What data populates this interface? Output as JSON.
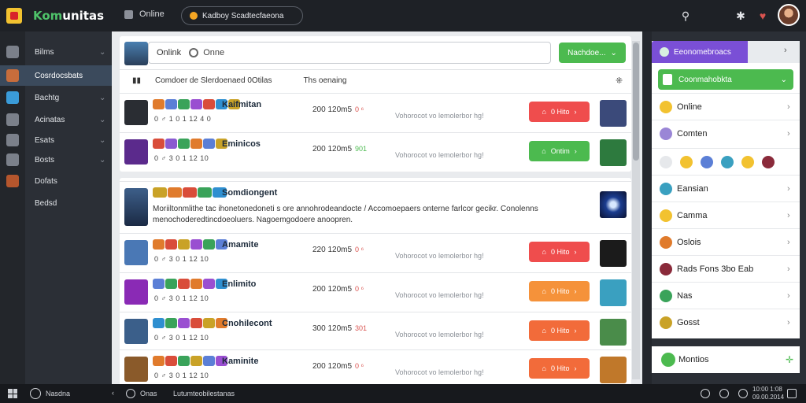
{
  "topbar": {
    "app_name_prefix": "Kom",
    "app_name_rest": "unitas",
    "nav_online": "Online",
    "pill_label": "Kadboy Scadtecfaeona"
  },
  "sidebar": {
    "items": [
      {
        "label": "Bilms",
        "icon": "grid-icon",
        "chevron": "⌄",
        "color": "#7b808a"
      },
      {
        "label": "Cosrdocsbats",
        "icon": "user-avatar-icon",
        "chevron": "",
        "color": "#c76d3c"
      },
      {
        "label": "Bachtg",
        "icon": "game-icon",
        "chevron": "⌄",
        "color": "#3a9bd8"
      },
      {
        "label": "Acinatas",
        "icon": "chat-icon",
        "chevron": "⌄",
        "color": "#7b808a"
      },
      {
        "label": "Esats",
        "icon": "bubble-icon",
        "chevron": "⌄",
        "color": "#7b808a"
      },
      {
        "label": "Bosts",
        "icon": "list-icon",
        "chevron": "⌄",
        "color": "#7b808a"
      },
      {
        "label": "Dofats",
        "icon": "character-icon",
        "chevron": "",
        "color": "#b5562d"
      },
      {
        "label": "Bedsd",
        "icon": "",
        "chevron": "",
        "color": ""
      }
    ]
  },
  "main": {
    "search": {
      "label": "Onlink",
      "placeholder": "Onne"
    },
    "action_button": "Nachdoe...",
    "filter": {
      "text1": "Comdoer de Slerdoenaed 0Otilas",
      "text2": "Ths oenaing"
    },
    "rows": [
      {
        "name": "Kaifmitan",
        "meta": "0 ♂ 1 0 1 12 4 0",
        "stats": "200 120m5",
        "stat_mark": "0 ⁶",
        "stat_green": false,
        "desc": "Vohorocot vo lemolerbor hg!",
        "action": "0 Hito",
        "action_color": "#ef4d4d",
        "avatar_color": "#2a2d33",
        "thumb_color": "#3b4a7a",
        "badges": [
          "#e07b2c",
          "#5b7fd6",
          "#3aa35a",
          "#9a4fd1",
          "#d94d3a",
          "#2f8fd0",
          "#c9a227"
        ]
      },
      {
        "name": "Eminicos",
        "meta": "0 ♂ 3 0 1 12 10",
        "stats": "200 120m5",
        "stat_mark": "901",
        "stat_green": true,
        "desc": "Vohorocot vo lemolerbor hg!",
        "action": "Ontim",
        "action_color": "#4cba4f",
        "avatar_color": "#5b2a8c",
        "thumb_color": "#2d7a3e",
        "badges": [
          "#d94d3a",
          "#8a5bd1",
          "#3aa35a",
          "#e07b2c",
          "#5b7fd6",
          "#c9a227"
        ]
      },
      {
        "name": "Amamite",
        "meta": "0 ♂ 3 0 1 12 10",
        "stats": "220 120m5",
        "stat_mark": "0 ⁶",
        "stat_green": false,
        "desc": "Vohorocot vo lemolerbor hg!",
        "action": "0 Hito",
        "action_color": "#ef4d4d",
        "avatar_color": "#4a78b5",
        "thumb_color": "#1b1b1b",
        "badges": [
          "#e07b2c",
          "#d94d3a",
          "#c9a227",
          "#9a4fd1",
          "#3aa35a",
          "#5b7fd6"
        ]
      },
      {
        "name": "Enlimito",
        "meta": "0 ♂ 3 0 1 12 10",
        "stats": "200 120m5",
        "stat_mark": "0 ⁶",
        "stat_green": false,
        "desc": "Vohorocot vo lemolerbor hg!",
        "action": "0 Hito",
        "action_color": "#f5923a",
        "avatar_color": "#8a2ab5",
        "thumb_color": "#3aa0c0",
        "badges": [
          "#5b7fd6",
          "#3aa35a",
          "#d94d3a",
          "#e07b2c",
          "#9a4fd1",
          "#2f8fd0"
        ]
      },
      {
        "name": "Cnohilecont",
        "meta": "0 ♂ 3 0 1 12 10",
        "stats": "300 120m5",
        "stat_mark": "301",
        "stat_green": false,
        "desc": "Vohorocot vo lemolerbor hg!",
        "action": "0 Hito",
        "action_color": "#f26b3a",
        "avatar_color": "#3b5f8a",
        "thumb_color": "#4a8c4a",
        "badges": [
          "#2f8fd0",
          "#3aa35a",
          "#9a4fd1",
          "#d94d3a",
          "#c9a227",
          "#e07b2c"
        ]
      },
      {
        "name": "Kaminite",
        "meta": "0 ♂ 3 0 1 12 10",
        "stats": "200 120m5",
        "stat_mark": "0 ⁶",
        "stat_green": false,
        "desc": "Vohorocot vo lemolerbor hg!",
        "action": "0 Hito",
        "action_color": "#f26b3a",
        "avatar_color": "#8a5a2a",
        "thumb_color": "#c0782a",
        "badges": [
          "#e07b2c",
          "#d94d3a",
          "#3aa35a",
          "#c9a227",
          "#5b7fd6",
          "#9a4fd1"
        ]
      }
    ],
    "feature": {
      "name": "Somdiongent",
      "text": "Moriiltonmlithe tac ihonetonedoneti s ore annohrodeandocte / Accomoepaers onterne farlcor gecikr. Conolenns menochoderedtincdoeoluers. Nagoemgodoere anoopren.",
      "badges": [
        "#c9a227",
        "#e07b2c",
        "#d94d3a",
        "#3aa35a",
        "#2f8fd0"
      ]
    }
  },
  "right_panel": {
    "tab_label": "Eeonomebroacs",
    "dropdown_label": "Coonmahobkta",
    "items": [
      {
        "label": "Online",
        "icon_color": "#f2c230",
        "icon": "smile-icon"
      },
      {
        "label": "Comten",
        "icon_color": "#9a86d6",
        "icon": "puzzle-icon"
      },
      {
        "label": "Eansian",
        "icon_color": "#3aa0c0",
        "icon": "controller-icon"
      },
      {
        "label": "Camma",
        "icon_color": "#f2c230",
        "icon": "card-icon"
      },
      {
        "label": "Oslois",
        "icon_color": "#e07b2c",
        "icon": "group-icon"
      },
      {
        "label": "Rads Fons 3bo Eab",
        "icon_color": "#8a2a3a",
        "icon": "avatar-icon"
      },
      {
        "label": "Nas",
        "icon_color": "#3aa35a",
        "icon": "leaf-icon"
      },
      {
        "label": "Gosst",
        "icon_color": "#c9a227",
        "icon": "box-icon"
      }
    ],
    "emojis": [
      "#e6e8eb",
      "#f2c230",
      "#5b7fd6",
      "#3aa0c0",
      "#f2c230",
      "#8a2a3a"
    ],
    "footer_label": "Montios"
  },
  "taskbar": {
    "search_text": "Nasdna",
    "app1": "Onas",
    "app2": "Lutumteobilestanas",
    "clock_line1": "10:00 1:08",
    "clock_line2": "09.00.2014"
  }
}
